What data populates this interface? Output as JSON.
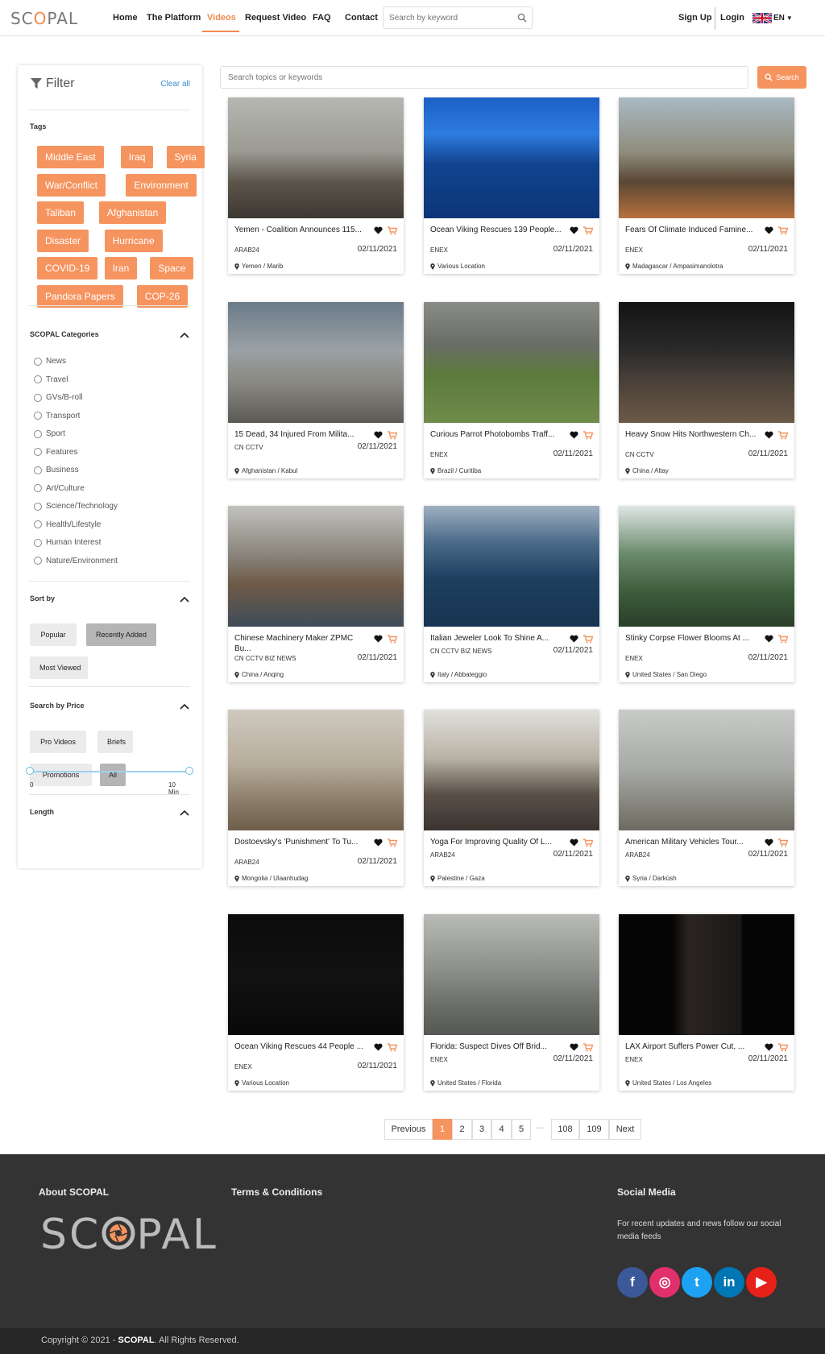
{
  "brand": {
    "logo_prefix": "SC",
    "logo_o": "O",
    "logo_suffix": "PAL",
    "accent": "#f6945f",
    "link": "#3c8dd6"
  },
  "nav": {
    "home": "Home",
    "platform": "The Platform",
    "videos": "Videos",
    "request": "Request Video",
    "faq": "FAQ",
    "contact": "Contact"
  },
  "header_search": {
    "placeholder": "Search by keyword"
  },
  "account": {
    "signup": "Sign Up",
    "login": "Login",
    "language": "EN"
  },
  "filter": {
    "title": "Filter",
    "clear_all": "Clear all",
    "tags_label": "Tags",
    "tags": [
      "Middle East",
      "Iraq",
      "Syria",
      "War/Conflict",
      "Environment",
      "Taliban",
      "Afghanistan",
      "Disaster",
      "Hurricane",
      "COVID-19",
      "Iran",
      "Space",
      "Pandora Papers",
      "COP-26"
    ],
    "categories_label": "SCOPAL Categories",
    "categories": [
      "News",
      "Travel",
      "GVs/B-roll",
      "Transport",
      "Sport",
      "Features",
      "Business",
      "Art/Culture",
      "Science/Technology",
      "Health/Lifestyle",
      "Human Interest",
      "Nature/Environment"
    ],
    "sort_label": "Sort by",
    "sort_options": [
      "Popular",
      "Recently Added",
      "Most Viewed"
    ],
    "sort_selected": "Recently Added",
    "price_label": "Search by Price",
    "price_options": [
      "Pro Videos",
      "Briefs",
      "Promotions",
      "All"
    ],
    "price_selected": "All",
    "length_label": "Length",
    "length_min": "0",
    "length_max": "10 Min"
  },
  "main_search": {
    "placeholder": "Search topics or keywords",
    "button": "Search"
  },
  "videos": [
    {
      "title": "Yemen - Coalition Announces 115...",
      "agency": "ARAB24",
      "date": "02/11/2021",
      "location": "Yemen / Marib"
    },
    {
      "title": "Ocean Viking Rescues 139 People...",
      "agency": "ENEX",
      "date": "02/11/2021",
      "location": "Various Location"
    },
    {
      "title": "Fears Of Climate Induced Famine...",
      "agency": "ENEX",
      "date": "02/11/2021",
      "location": "Madagascar / Ampasimanolotra"
    },
    {
      "title": "15 Dead, 34 Injured From Milita...",
      "agency": "CN CCTV",
      "date": "02/11/2021",
      "location": "Afghanistan / Kabul"
    },
    {
      "title": "Curious Parrot Photobombs Traff...",
      "agency": "ENEX",
      "date": "02/11/2021",
      "location": "Brazil / Curitiba"
    },
    {
      "title": "Heavy Snow Hits Northwestern Ch...",
      "agency": "CN CCTV",
      "date": "02/11/2021",
      "location": "China / Altay"
    },
    {
      "title": "Chinese Machinery Maker ZPMC Bu...",
      "agency": "CN CCTV BIZ NEWS",
      "date": "02/11/2021",
      "location": "China / Anqing"
    },
    {
      "title": "Italian Jeweler Look To Shine A...",
      "agency": "CN CCTV BIZ NEWS",
      "date": "02/11/2021",
      "location": "Italy / Abbateggio"
    },
    {
      "title": "Stinky Corpse Flower Blooms At ...",
      "agency": "ENEX",
      "date": "02/11/2021",
      "location": "United States / San Diego"
    },
    {
      "title": "Dostoevsky's 'Punishment' To Tu...",
      "agency": "ARAB24",
      "date": "02/11/2021",
      "location": "Mongolia / Ulaanhudag"
    },
    {
      "title": "Yoga For Improving Quality Of L...",
      "agency": "ARAB24",
      "date": "02/11/2021",
      "location": "Palestine / Gaza"
    },
    {
      "title": "American Military Vehicles Tour...",
      "agency": "ARAB24",
      "date": "02/11/2021",
      "location": "Syria / Darkūsh"
    },
    {
      "title": "Ocean Viking Rescues 44 People ...",
      "agency": "ENEX",
      "date": "02/11/2021",
      "location": "Various Location"
    },
    {
      "title": "Florida: Suspect Dives Off Brid...",
      "agency": "ENEX",
      "date": "02/11/2021",
      "location": "United States / Florida"
    },
    {
      "title": "LAX Airport Suffers Power Cut, ...",
      "agency": "ENEX",
      "date": "02/11/2021",
      "location": "United States / Los Angeles"
    }
  ],
  "pagination": {
    "previous": "Previous",
    "pages": [
      "1",
      "2",
      "3",
      "4",
      "5"
    ],
    "ellipsis": "...",
    "tail": [
      "108",
      "109"
    ],
    "next": "Next",
    "current": "1"
  },
  "footer": {
    "about": "About SCOPAL",
    "terms": "Terms & Conditions",
    "social": "Social Media",
    "social_text": "For recent updates and news follow our social media feeds",
    "copyright_prefix": "Copyright © 2021 - ",
    "copyright_brand": "SCOPAL",
    "copyright_suffix": ". All Rights Reserved."
  },
  "social_icons": [
    {
      "name": "facebook-icon",
      "glyph": "f",
      "color": "#3b5998"
    },
    {
      "name": "instagram-icon",
      "glyph": "◎",
      "color": "#e1306c"
    },
    {
      "name": "twitter-icon",
      "glyph": "t",
      "color": "#1da1f2"
    },
    {
      "name": "linkedin-icon",
      "glyph": "in",
      "color": "#0077b5"
    },
    {
      "name": "youtube-icon",
      "glyph": "▶",
      "color": "#e62117"
    }
  ]
}
